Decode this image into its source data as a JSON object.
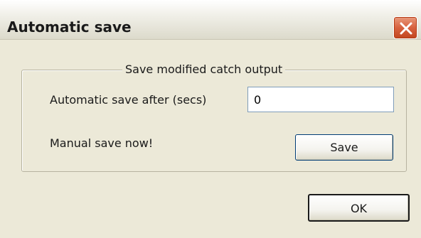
{
  "window": {
    "title": "Automatic save",
    "close_icon": "close-icon"
  },
  "group": {
    "legend": "Save modified catch output",
    "auto_save_label": "Automatic save after (secs)",
    "auto_save_value": "0",
    "manual_save_label": "Manual save now!",
    "save_button_label": "Save"
  },
  "footer": {
    "ok_button_label": "OK"
  },
  "colors": {
    "dialog_background": "#ece9d8",
    "close_button": "#d8623f",
    "input_border": "#7f9db9"
  }
}
